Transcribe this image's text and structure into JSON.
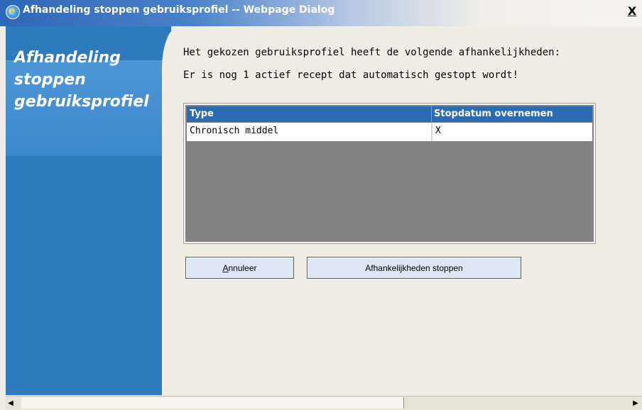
{
  "window": {
    "title": "Afhandeling stoppen gebruiksprofiel -- Webpage Dialog",
    "close_label": "X"
  },
  "sidebar": {
    "title": "Afhandeling\nstoppen\ngebruiksprofiel"
  },
  "main": {
    "line1": "Het gekozen gebruiksprofiel heeft de volgende afhankelijkheden:",
    "line2": "Er is nog 1 actief recept dat automatisch gestopt wordt!"
  },
  "table": {
    "columns": [
      "Type",
      "Stopdatum overnemen"
    ],
    "rows": [
      [
        "Chronisch middel",
        "X"
      ]
    ]
  },
  "buttons": {
    "cancel_mnemonic": "A",
    "cancel_rest": "nnuleer",
    "stop_label": "Afhankelijkheden stoppen"
  },
  "icons": {
    "title_icon": "ie-icon",
    "scroll_left": "arrow-left-icon",
    "scroll_right": "arrow-right-icon"
  }
}
